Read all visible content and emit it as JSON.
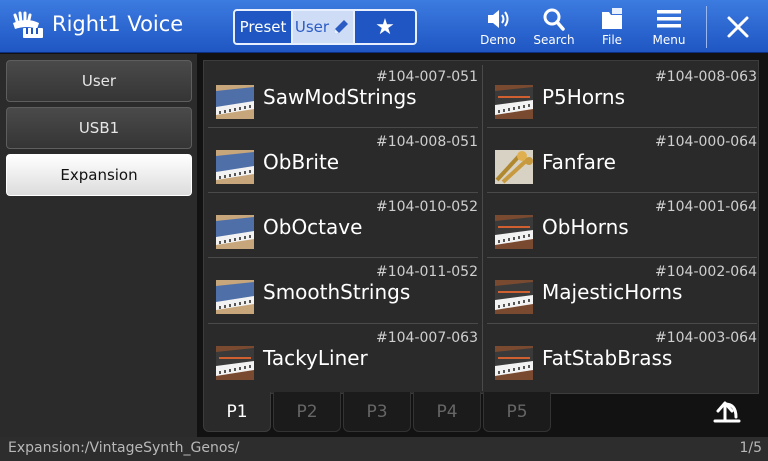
{
  "header": {
    "title": "Right1 Voice",
    "accent": "#2a62d0",
    "segments": [
      {
        "label": "Preset",
        "icon": null,
        "selected": false
      },
      {
        "label": "User",
        "icon": "pencil-icon",
        "selected": true
      },
      {
        "label": "",
        "icon": "star-icon",
        "selected": false
      }
    ],
    "buttons": {
      "demo": "Demo",
      "search": "Search",
      "file": "File",
      "menu": "Menu"
    }
  },
  "drives": [
    {
      "label": "User",
      "selected": false
    },
    {
      "label": "USB1",
      "selected": false
    },
    {
      "label": "Expansion",
      "selected": true
    }
  ],
  "voices": [
    {
      "number": "#104-007-051",
      "name": "SawModStrings",
      "thumb": "blue-synth"
    },
    {
      "number": "#104-008-063",
      "name": "P5Horns",
      "thumb": "dark-synth"
    },
    {
      "number": "#104-008-051",
      "name": "ObBrite",
      "thumb": "blue-synth"
    },
    {
      "number": "#104-000-064",
      "name": "Fanfare",
      "thumb": "brass-horns"
    },
    {
      "number": "#104-010-052",
      "name": "ObOctave",
      "thumb": "blue-synth"
    },
    {
      "number": "#104-001-064",
      "name": "ObHorns",
      "thumb": "dark-synth"
    },
    {
      "number": "#104-011-052",
      "name": "SmoothStrings",
      "thumb": "blue-synth"
    },
    {
      "number": "#104-002-064",
      "name": "MajesticHorns",
      "thumb": "dark-synth"
    },
    {
      "number": "#104-007-063",
      "name": "TackyLiner",
      "thumb": "dark-synth"
    },
    {
      "number": "#104-003-064",
      "name": "FatStabBrass",
      "thumb": "dark-synth"
    }
  ],
  "pages": [
    {
      "label": "P1",
      "active": true
    },
    {
      "label": "P2",
      "active": false
    },
    {
      "label": "P3",
      "active": false
    },
    {
      "label": "P4",
      "active": false
    },
    {
      "label": "P5",
      "active": false
    }
  ],
  "status": {
    "path": "Expansion:/VintageSynth_Genos/",
    "page_info": "1/5"
  }
}
